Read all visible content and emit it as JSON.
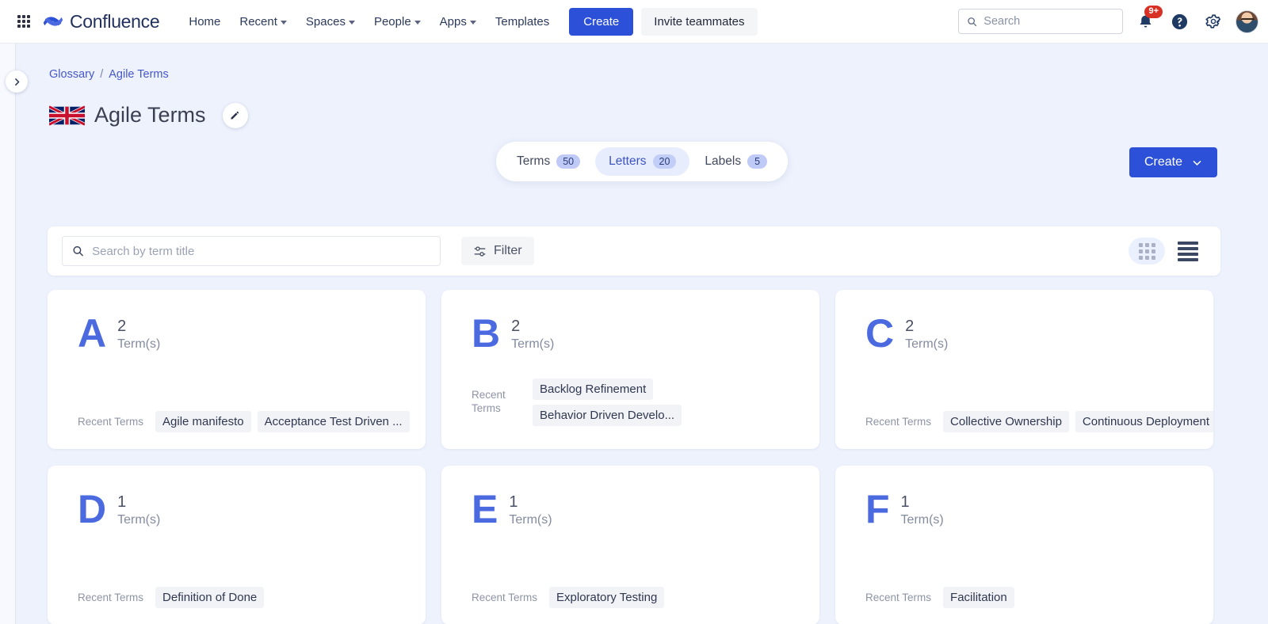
{
  "topnav": {
    "app_switcher_icon": "grid-apps-icon",
    "brand": "Confluence",
    "brand_icon": "confluence-logo-icon",
    "links": [
      {
        "label": "Home",
        "has_caret": false
      },
      {
        "label": "Recent",
        "has_caret": true
      },
      {
        "label": "Spaces",
        "has_caret": true
      },
      {
        "label": "People",
        "has_caret": true
      },
      {
        "label": "Apps",
        "has_caret": true
      },
      {
        "label": "Templates",
        "has_caret": false
      }
    ],
    "create_label": "Create",
    "invite_label": "Invite teammates",
    "search_placeholder": "Search",
    "search_value": "",
    "search_icon": "search-icon",
    "notifications_icon": "bell-icon",
    "notifications_badge": "9+",
    "help_icon": "help-circle-icon",
    "settings_icon": "gear-icon",
    "avatar_icon": "user-avatar"
  },
  "rail": {
    "toggle_icon": "chevron-right-icon"
  },
  "breadcrumb": {
    "parent": "Glossary",
    "separator": "/",
    "current": "Agile Terms"
  },
  "header": {
    "flag_icon": "uk-flag-icon",
    "title": "Agile Terms",
    "edit_icon": "pencil-icon",
    "create_label": "Create",
    "create_caret_icon": "chevron-down-icon"
  },
  "stats": [
    {
      "label": "Terms",
      "count": "50",
      "active": false
    },
    {
      "label": "Letters",
      "count": "20",
      "active": true
    },
    {
      "label": "Labels",
      "count": "5",
      "active": false
    }
  ],
  "toolbar": {
    "search_placeholder": "Search by term title",
    "search_value": "",
    "search_icon": "search-icon",
    "filter_label": "Filter",
    "filter_icon": "sliders-icon",
    "grid_view_icon": "grid-view-icon",
    "list_view_icon": "list-view-icon",
    "active_view": "grid"
  },
  "cards": {
    "recent_label": "Recent Terms",
    "items": [
      {
        "letter": "A",
        "count": "2",
        "count_label": "Term(s)",
        "stacked": false,
        "terms": [
          "Agile manifesto",
          "Acceptance Test Driven ..."
        ]
      },
      {
        "letter": "B",
        "count": "2",
        "count_label": "Term(s)",
        "stacked": true,
        "terms": [
          "Backlog Refinement",
          "Behavior Driven Develo..."
        ]
      },
      {
        "letter": "C",
        "count": "2",
        "count_label": "Term(s)",
        "stacked": false,
        "terms": [
          "Collective Ownership",
          "Continuous Deployment"
        ]
      },
      {
        "letter": "D",
        "count": "1",
        "count_label": "Term(s)",
        "stacked": false,
        "terms": [
          "Definition of Done"
        ]
      },
      {
        "letter": "E",
        "count": "1",
        "count_label": "Term(s)",
        "stacked": false,
        "terms": [
          "Exploratory Testing"
        ]
      },
      {
        "letter": "F",
        "count": "1",
        "count_label": "Term(s)",
        "stacked": false,
        "terms": [
          "Facilitation"
        ]
      }
    ]
  },
  "colors": {
    "brand_blue": "#2c50d8",
    "letter_blue": "#4b6ae0",
    "page_bg": "#eef2fd",
    "badge_red": "#d93025",
    "chip_bg": "#f2f3f6"
  }
}
